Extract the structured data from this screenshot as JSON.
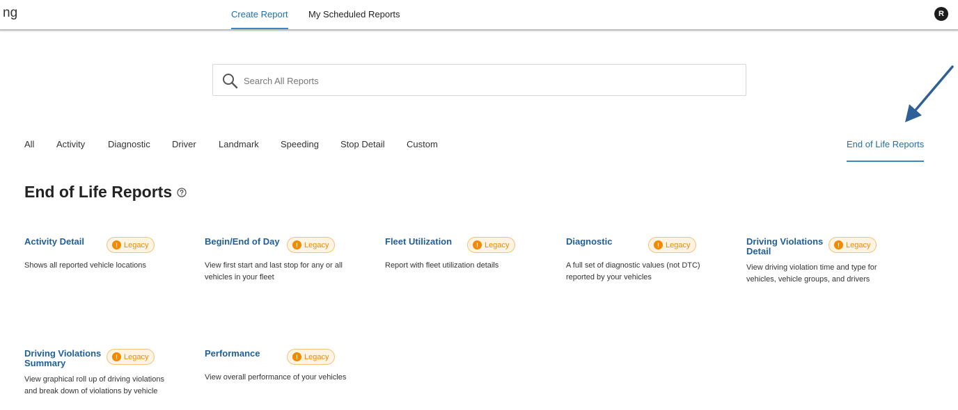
{
  "app": {
    "title_fragment": "ng"
  },
  "top_nav": {
    "tabs": [
      {
        "label": "Create Report",
        "active": true
      },
      {
        "label": "My Scheduled Reports",
        "active": false
      }
    ]
  },
  "user": {
    "avatar_initial": "R"
  },
  "search": {
    "placeholder": "Search All Reports",
    "value": ""
  },
  "categories": [
    {
      "label": "All",
      "active": false
    },
    {
      "label": "Activity",
      "active": false
    },
    {
      "label": "Diagnostic",
      "active": false
    },
    {
      "label": "Driver",
      "active": false
    },
    {
      "label": "Landmark",
      "active": false
    },
    {
      "label": "Speeding",
      "active": false
    },
    {
      "label": "Stop Detail",
      "active": false
    },
    {
      "label": "Custom",
      "active": false
    },
    {
      "label": "End of Life Reports",
      "active": true
    }
  ],
  "section": {
    "title": "End of Life Reports",
    "help_icon": "question-circle-icon"
  },
  "badge_label": "Legacy",
  "reports": [
    {
      "title": "Activity Detail",
      "badge": "Legacy",
      "description": "Shows all reported vehicle locations"
    },
    {
      "title": "Begin/End of Day",
      "badge": "Legacy",
      "description": "View first start and last stop for any or all vehicles in your fleet"
    },
    {
      "title": "Fleet Utilization",
      "badge": "Legacy",
      "description": "Report with fleet utilization details"
    },
    {
      "title": "Diagnostic",
      "badge": "Legacy",
      "description": "A full set of diagnostic values (not DTC) reported by your vehicles"
    },
    {
      "title": "Driving Violations Detail",
      "badge": "Legacy",
      "description": "View driving violation time and type for vehicles, vehicle groups, and drivers"
    },
    {
      "title": "Driving Violations Summary",
      "badge": "Legacy",
      "description": "View graphical roll up of driving violations and break down of violations by vehicle"
    },
    {
      "title": "Performance",
      "badge": "Legacy",
      "description": "View overall performance of your vehicles"
    }
  ],
  "colors": {
    "accent": "#1f6fad",
    "link": "#1f5f99",
    "legacy_orange": "#f08a00",
    "legacy_bg": "#fff4e3",
    "annotation_arrow": "#2e5f96"
  }
}
